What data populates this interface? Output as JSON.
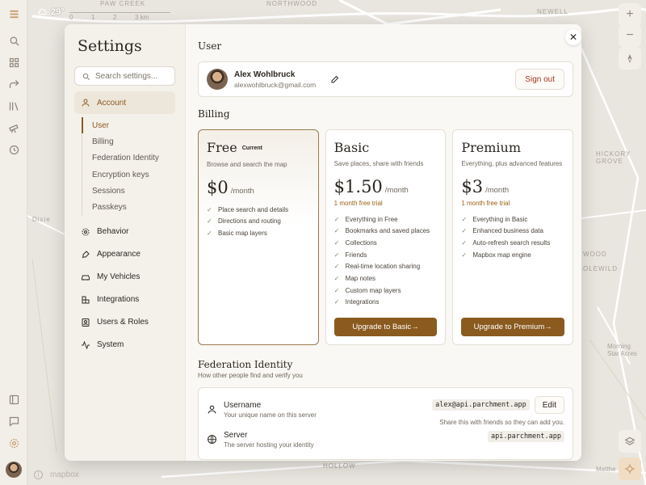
{
  "map": {
    "labels": [
      "PAW CREEK",
      "NORTHWOOD",
      "NEWELL",
      "HICKORY GROVE",
      "Dixie",
      "HOLLOW",
      "Morning Star Acres",
      "Matthe",
      "WOOD",
      "OLEWILD",
      "mapbox"
    ],
    "scale_labels": [
      "0",
      "1",
      "2",
      "3 km"
    ]
  },
  "weather": {
    "temp": "29°"
  },
  "settings": {
    "title": "Settings",
    "search_placeholder": "Search settings...",
    "nav": {
      "account": "Account",
      "sub": [
        "User",
        "Billing",
        "Federation Identity",
        "Encryption keys",
        "Sessions",
        "Passkeys"
      ],
      "behavior": "Behavior",
      "appearance": "Appearance",
      "vehicles": "My Vehicles",
      "integrations": "Integrations",
      "users_roles": "Users & Roles",
      "system": "System"
    }
  },
  "user": {
    "section_title": "User",
    "name": "Alex Wohlbruck",
    "email": "alexwohlbruck@gmail.com",
    "sign_out": "Sign out"
  },
  "billing": {
    "section_title": "Billing",
    "plans": [
      {
        "name": "Free",
        "badge": "Current",
        "desc": "Browse and search the map",
        "price": "$0",
        "per": "/month",
        "trial": "",
        "features": [
          "Place search and details",
          "Directions and routing",
          "Basic map layers"
        ],
        "cta": ""
      },
      {
        "name": "Basic",
        "badge": "",
        "desc": "Save places, share with friends",
        "price": "$1.50",
        "per": "/month",
        "trial": "1 month free trial",
        "features": [
          "Everything in Free",
          "Bookmarks and saved places",
          "Collections",
          "Friends",
          "Real-time location sharing",
          "Map notes",
          "Custom map layers",
          "Integrations"
        ],
        "cta": "Upgrade to Basic"
      },
      {
        "name": "Premium",
        "badge": "",
        "desc": "Everything, plus advanced features",
        "price": "$3",
        "per": "/month",
        "trial": "1 month free trial",
        "features": [
          "Everything in Basic",
          "Enhanced business data",
          "Auto-refresh search results",
          "Mapbox map engine"
        ],
        "cta": "Upgrade to Premium"
      }
    ]
  },
  "federation": {
    "section_title": "Federation Identity",
    "subtitle": "How other people find and verify you",
    "username_label": "Username",
    "username_sub": "Your unique name on this server",
    "username_value": "alex@api.parchment.app",
    "edit": "Edit",
    "share_hint": "Share this with friends so they can add you.",
    "server_label": "Server",
    "server_sub": "The server hosting your identity",
    "server_value": "api.parchment.app"
  },
  "colors": {
    "accent": "#8a5a1f",
    "danger": "#a0341f",
    "map_bg": "#e9e6df"
  }
}
